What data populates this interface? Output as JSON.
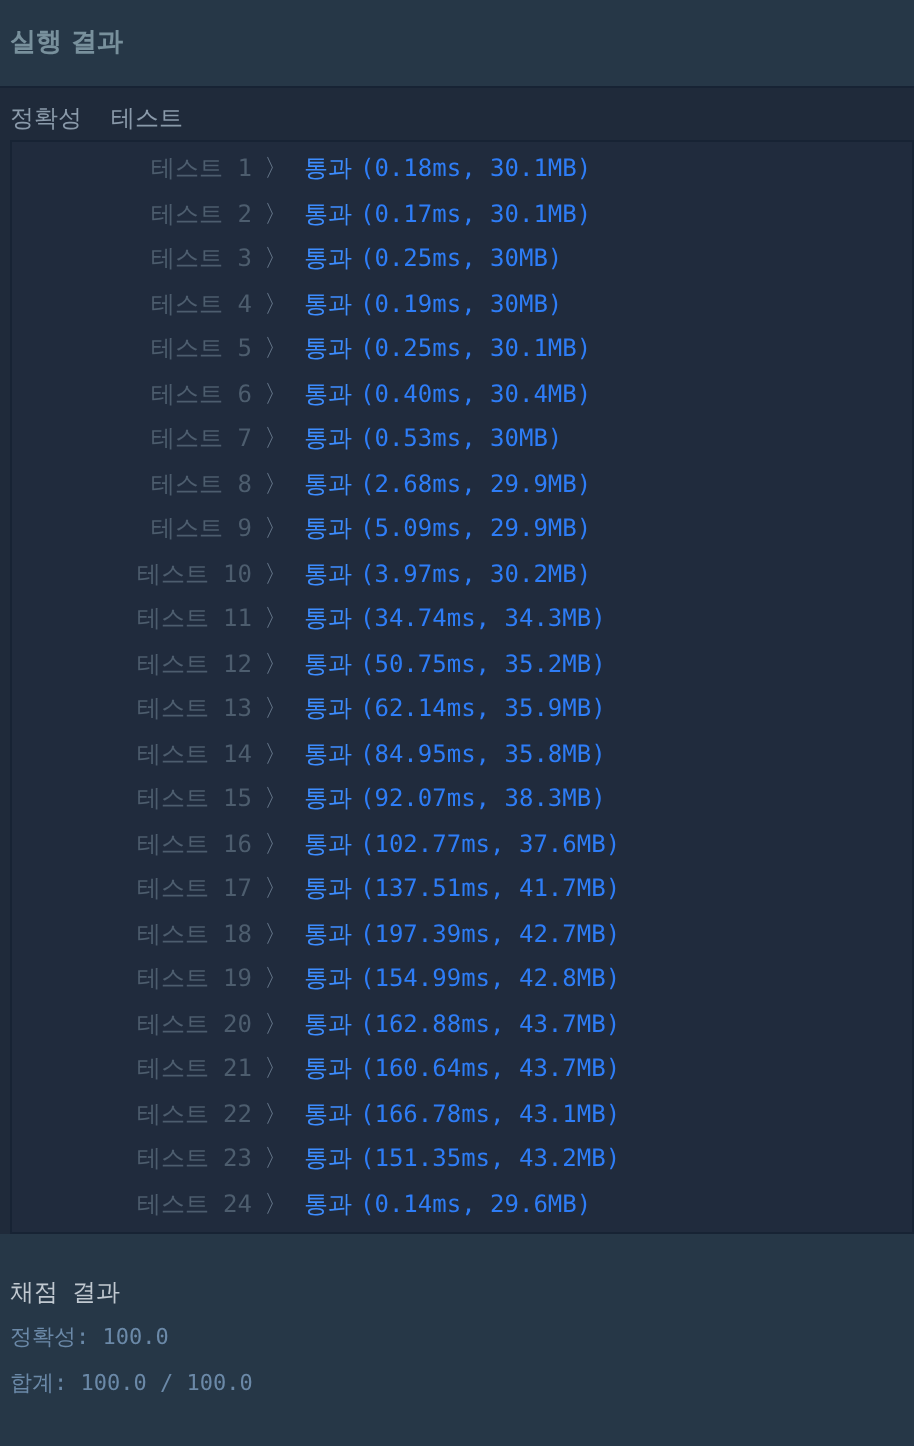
{
  "header": {
    "title": "실행 결과"
  },
  "section_title": "정확성  테스트",
  "tests": [
    {
      "label": "테스트 1",
      "arrow": "〉",
      "status": "통과",
      "detail": "(0.18ms, 30.1MB)"
    },
    {
      "label": "테스트 2",
      "arrow": "〉",
      "status": "통과",
      "detail": "(0.17ms, 30.1MB)"
    },
    {
      "label": "테스트 3",
      "arrow": "〉",
      "status": "통과",
      "detail": "(0.25ms, 30MB)"
    },
    {
      "label": "테스트 4",
      "arrow": "〉",
      "status": "통과",
      "detail": "(0.19ms, 30MB)"
    },
    {
      "label": "테스트 5",
      "arrow": "〉",
      "status": "통과",
      "detail": "(0.25ms, 30.1MB)"
    },
    {
      "label": "테스트 6",
      "arrow": "〉",
      "status": "통과",
      "detail": "(0.40ms, 30.4MB)"
    },
    {
      "label": "테스트 7",
      "arrow": "〉",
      "status": "통과",
      "detail": "(0.53ms, 30MB)"
    },
    {
      "label": "테스트 8",
      "arrow": "〉",
      "status": "통과",
      "detail": "(2.68ms, 29.9MB)"
    },
    {
      "label": "테스트 9",
      "arrow": "〉",
      "status": "통과",
      "detail": "(5.09ms, 29.9MB)"
    },
    {
      "label": "테스트 10",
      "arrow": "〉",
      "status": "통과",
      "detail": "(3.97ms, 30.2MB)"
    },
    {
      "label": "테스트 11",
      "arrow": "〉",
      "status": "통과",
      "detail": "(34.74ms, 34.3MB)"
    },
    {
      "label": "테스트 12",
      "arrow": "〉",
      "status": "통과",
      "detail": "(50.75ms, 35.2MB)"
    },
    {
      "label": "테스트 13",
      "arrow": "〉",
      "status": "통과",
      "detail": "(62.14ms, 35.9MB)"
    },
    {
      "label": "테스트 14",
      "arrow": "〉",
      "status": "통과",
      "detail": "(84.95ms, 35.8MB)"
    },
    {
      "label": "테스트 15",
      "arrow": "〉",
      "status": "통과",
      "detail": "(92.07ms, 38.3MB)"
    },
    {
      "label": "테스트 16",
      "arrow": "〉",
      "status": "통과",
      "detail": "(102.77ms, 37.6MB)"
    },
    {
      "label": "테스트 17",
      "arrow": "〉",
      "status": "통과",
      "detail": "(137.51ms, 41.7MB)"
    },
    {
      "label": "테스트 18",
      "arrow": "〉",
      "status": "통과",
      "detail": "(197.39ms, 42.7MB)"
    },
    {
      "label": "테스트 19",
      "arrow": "〉",
      "status": "통과",
      "detail": "(154.99ms, 42.8MB)"
    },
    {
      "label": "테스트 20",
      "arrow": "〉",
      "status": "통과",
      "detail": "(162.88ms, 43.7MB)"
    },
    {
      "label": "테스트 21",
      "arrow": "〉",
      "status": "통과",
      "detail": "(160.64ms, 43.7MB)"
    },
    {
      "label": "테스트 22",
      "arrow": "〉",
      "status": "통과",
      "detail": "(166.78ms, 43.1MB)"
    },
    {
      "label": "테스트 23",
      "arrow": "〉",
      "status": "통과",
      "detail": "(151.35ms, 43.2MB)"
    },
    {
      "label": "테스트 24",
      "arrow": "〉",
      "status": "통과",
      "detail": "(0.14ms, 29.6MB)"
    }
  ],
  "summary": {
    "title": "채점 결과",
    "lines": [
      "정확성: 100.0",
      "합계: 100.0 / 100.0"
    ]
  }
}
